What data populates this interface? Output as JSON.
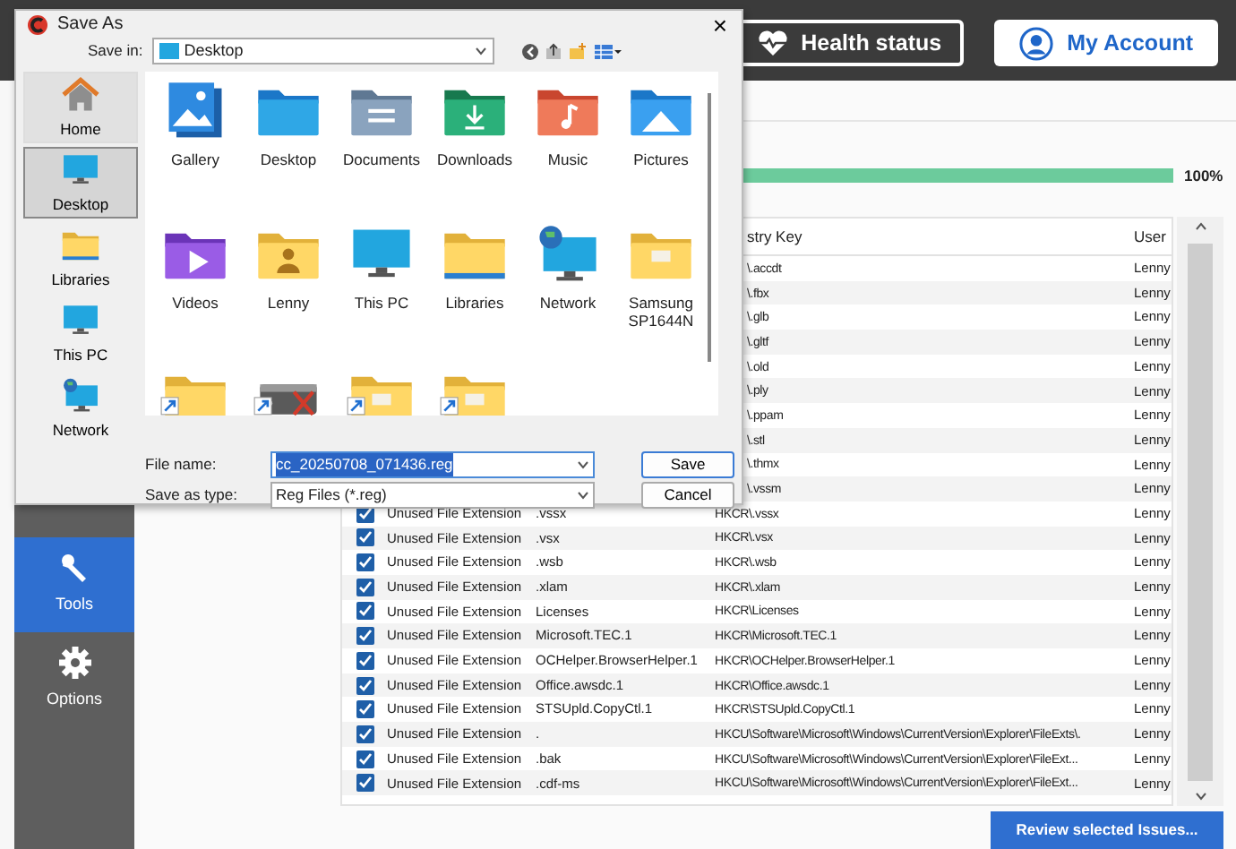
{
  "header": {
    "health_button": "Health status",
    "account_button": "My Account"
  },
  "sidebar": {
    "items": [
      {
        "label": "Tools",
        "selected": true
      },
      {
        "label": "Options",
        "selected": false
      }
    ]
  },
  "progress": {
    "level": 1,
    "reading": "100%"
  },
  "table": {
    "key_column": "stry Key",
    "user_column": "User",
    "rows": [
      {
        "kind": "covered",
        "key": "\\.accdt",
        "user": "Lenny"
      },
      {
        "kind": "covered",
        "key": "\\.fbx",
        "user": "Lenny"
      },
      {
        "kind": "covered",
        "key": "\\.glb",
        "user": "Lenny"
      },
      {
        "kind": "covered",
        "key": "\\.gltf",
        "user": "Lenny"
      },
      {
        "kind": "covered",
        "key": "\\.old",
        "user": "Lenny"
      },
      {
        "kind": "covered",
        "key": "\\.ply",
        "user": "Lenny"
      },
      {
        "kind": "covered",
        "key": "\\.ppam",
        "user": "Lenny"
      },
      {
        "kind": "covered",
        "key": "\\.stl",
        "user": "Lenny"
      },
      {
        "kind": "covered",
        "key": "\\.thmx",
        "user": "Lenny"
      },
      {
        "kind": "covered",
        "key": "\\.vssm",
        "user": "Lenny"
      },
      {
        "kind": "full",
        "checked": true,
        "type": "Unused File Extension",
        "value": ".vssx",
        "key": "HKCR\\.vssx",
        "user": "Lenny"
      },
      {
        "kind": "full",
        "checked": true,
        "type": "Unused File Extension",
        "value": ".vsx",
        "key": "HKCR\\.vsx",
        "user": "Lenny"
      },
      {
        "kind": "full",
        "checked": true,
        "type": "Unused File Extension",
        "value": ".wsb",
        "key": "HKCR\\.wsb",
        "user": "Lenny"
      },
      {
        "kind": "full",
        "checked": true,
        "type": "Unused File Extension",
        "value": ".xlam",
        "key": "HKCR\\.xlam",
        "user": "Lenny"
      },
      {
        "kind": "full",
        "checked": true,
        "type": "Unused File Extension",
        "value": "Licenses",
        "key": "HKCR\\Licenses",
        "user": "Lenny"
      },
      {
        "kind": "full",
        "checked": true,
        "type": "Unused File Extension",
        "value": "Microsoft.TEC.1",
        "key": "HKCR\\Microsoft.TEC.1",
        "user": "Lenny"
      },
      {
        "kind": "full",
        "checked": true,
        "type": "Unused File Extension",
        "value": "OCHelper.BrowserHelper.1",
        "key": "HKCR\\OCHelper.BrowserHelper.1",
        "user": "Lenny"
      },
      {
        "kind": "full",
        "checked": true,
        "type": "Unused File Extension",
        "value": "Office.awsdc.1",
        "key": "HKCR\\Office.awsdc.1",
        "user": "Lenny"
      },
      {
        "kind": "full",
        "checked": true,
        "type": "Unused File Extension",
        "value": "STSUpld.CopyCtl.1",
        "key": "HKCR\\STSUpld.CopyCtl.1",
        "user": "Lenny"
      },
      {
        "kind": "full",
        "checked": true,
        "type": "Unused File Extension",
        "value": ".",
        "key": "HKCU\\Software\\Microsoft\\Windows\\CurrentVersion\\Explorer\\FileExts\\.",
        "user": "Lenny"
      },
      {
        "kind": "full",
        "checked": true,
        "type": "Unused File Extension",
        "value": ".bak",
        "key": "HKCU\\Software\\Microsoft\\Windows\\CurrentVersion\\Explorer\\FileExt...",
        "user": "Lenny"
      },
      {
        "kind": "full",
        "checked": true,
        "type": "Unused File Extension",
        "value": ".cdf-ms",
        "key": "HKCU\\Software\\Microsoft\\Windows\\CurrentVersion\\Explorer\\FileExt...",
        "user": "Lenny"
      }
    ]
  },
  "review_button": "Review selected Issues...",
  "dialog": {
    "title": "Save As",
    "close": "×",
    "save_in_label": "Save in:",
    "save_in": "Desktop",
    "places": [
      {
        "label": "Home",
        "kind": "home",
        "selected": false,
        "hovered": true
      },
      {
        "label": "Desktop",
        "kind": "monitor",
        "selected": true,
        "hovered": false
      },
      {
        "label": "Libraries",
        "kind": "libraries",
        "selected": false,
        "hovered": false
      },
      {
        "label": "This PC",
        "kind": "monitor",
        "selected": false,
        "hovered": false
      },
      {
        "label": "Network",
        "kind": "network",
        "selected": false,
        "hovered": false
      }
    ],
    "items": [
      {
        "label": "Gallery",
        "kind": "gallery",
        "shortcut": false
      },
      {
        "label": "Desktop",
        "kind": "desktop",
        "shortcut": false
      },
      {
        "label": "Documents",
        "kind": "documents",
        "shortcut": false
      },
      {
        "label": "Downloads",
        "kind": "downloads",
        "shortcut": false
      },
      {
        "label": "Music",
        "kind": "music",
        "shortcut": false
      },
      {
        "label": "Pictures",
        "kind": "pictures",
        "shortcut": false
      },
      {
        "label": "Videos",
        "kind": "videos",
        "shortcut": false
      },
      {
        "label": "Lenny",
        "kind": "user",
        "shortcut": false
      },
      {
        "label": "This PC",
        "kind": "monitor",
        "shortcut": false
      },
      {
        "label": "Libraries",
        "kind": "libraries",
        "shortcut": false
      },
      {
        "label": "Network",
        "kind": "network",
        "shortcut": false
      },
      {
        "label": "Samsung SP1644N",
        "kind": "drivefolder",
        "shortcut": false
      },
      {
        "kind": "folder",
        "shortcut": true
      },
      {
        "kind": "drive",
        "shortcut": true
      },
      {
        "kind": "drivefolder",
        "shortcut": true
      },
      {
        "kind": "drivefolder",
        "shortcut": true
      }
    ],
    "file_name_label": "File name:",
    "file_name": "cc_20250708_071436.reg",
    "type_label": "Save as type:",
    "type": "Reg Files (*.reg)",
    "save_button": "Save",
    "cancel_button": "Cancel"
  }
}
